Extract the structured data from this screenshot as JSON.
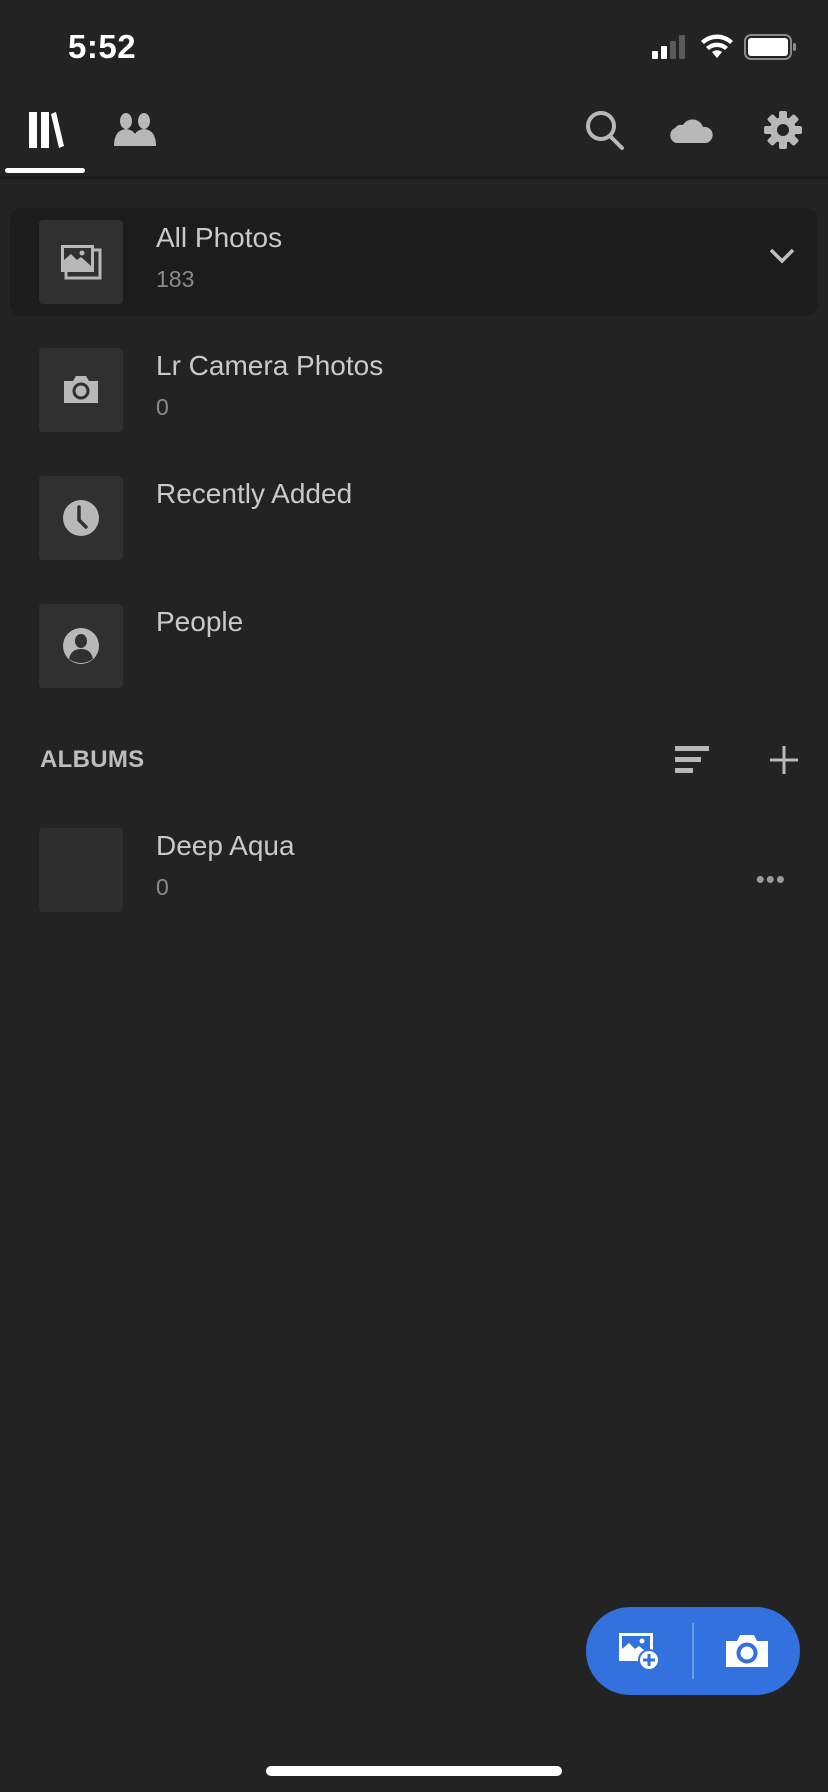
{
  "status_bar": {
    "time": "5:52",
    "signal_icon": "cellular-signal-icon",
    "wifi_icon": "wifi-icon",
    "battery_icon": "battery-icon"
  },
  "top_nav": {
    "tabs": [
      {
        "name": "library",
        "icon": "library-books-icon",
        "active": true
      },
      {
        "name": "shared",
        "icon": "people-icon",
        "active": false
      }
    ],
    "actions": [
      {
        "name": "search",
        "icon": "search-icon"
      },
      {
        "name": "cloud-sync",
        "icon": "cloud-icon"
      },
      {
        "name": "settings",
        "icon": "gear-icon"
      }
    ]
  },
  "library_items": [
    {
      "title": "All Photos",
      "count": "183",
      "icon": "photos-stack-icon",
      "selected": true,
      "expandable": true
    },
    {
      "title": "Lr Camera Photos",
      "count": "0",
      "icon": "camera-icon",
      "selected": false
    },
    {
      "title": "Recently Added",
      "count": "",
      "icon": "clock-icon",
      "selected": false
    },
    {
      "title": "People",
      "count": "",
      "icon": "person-icon",
      "selected": false
    }
  ],
  "albums": {
    "section_title": "ALBUMS",
    "sort_icon": "sort-icon",
    "add_icon": "plus-icon",
    "items": [
      {
        "title": "Deep Aqua",
        "count": "0",
        "more_label": "•••"
      }
    ]
  },
  "fab": {
    "add_photos_icon": "add-photo-icon",
    "camera_icon": "camera-icon",
    "color": "#3371de"
  },
  "colors": {
    "background": "#232323",
    "selected_row": "#1c1c1c",
    "thumb": "#303030",
    "accent": "#3371de"
  }
}
